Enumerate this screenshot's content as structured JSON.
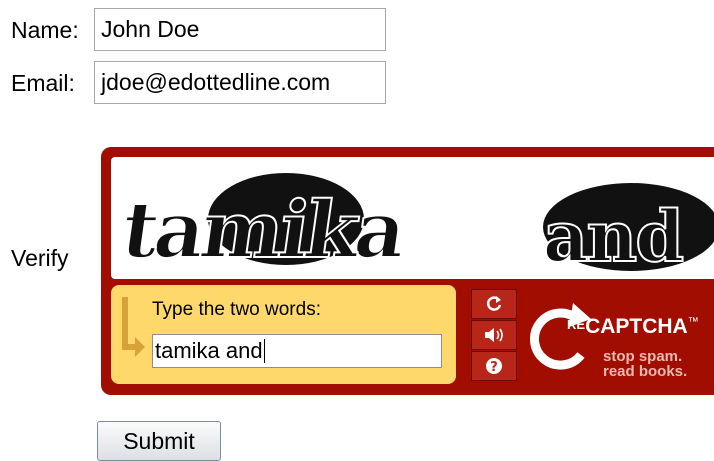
{
  "form": {
    "name_label": "Name:",
    "name_value": "John Doe",
    "email_label": "Email:",
    "email_value": "jdoe@edottedline.com",
    "verify_label": "Verify",
    "submit_label": "Submit"
  },
  "recaptcha": {
    "challenge_word_1": "tamika",
    "challenge_word_2": "and",
    "prompt": "Type the two words:",
    "answer_value": "tamika and",
    "logo_re": "RE",
    "logo_captcha": "CAPTCHA",
    "logo_tm": "™",
    "tagline_1": "stop spam.",
    "tagline_2": "read books.",
    "icons": [
      "refresh-icon",
      "audio-icon",
      "help-icon"
    ],
    "colors": {
      "frame": "#a10e00",
      "entry_panel": "#ffd86b"
    }
  }
}
